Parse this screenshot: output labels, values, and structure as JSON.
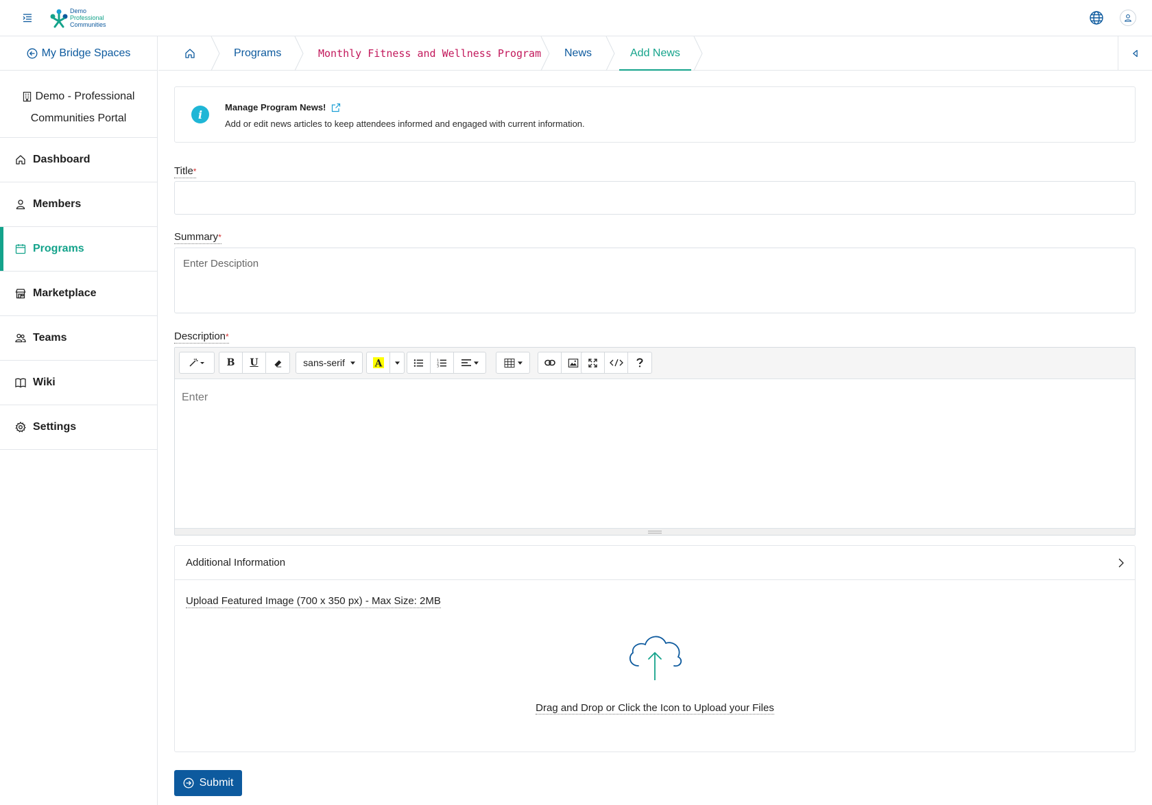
{
  "header": {
    "logo": {
      "line1": "Demo",
      "line2": "Professional",
      "line3": "Communities"
    },
    "icons": [
      "menu-icon",
      "globe-icon",
      "user-icon"
    ]
  },
  "sidebar": {
    "back_label": "My Bridge Spaces",
    "portal_line1": "Demo - Professional",
    "portal_line2": "Communities Portal",
    "items": [
      {
        "label": "Dashboard",
        "icon": "home-icon",
        "active": false
      },
      {
        "label": "Members",
        "icon": "user-icon",
        "active": false
      },
      {
        "label": "Programs",
        "icon": "calendar-icon",
        "active": true
      },
      {
        "label": "Marketplace",
        "icon": "store-icon",
        "active": false
      },
      {
        "label": "Teams",
        "icon": "team-icon",
        "active": false
      },
      {
        "label": "Wiki",
        "icon": "book-icon",
        "active": false
      },
      {
        "label": "Settings",
        "icon": "gear-icon",
        "active": false
      }
    ]
  },
  "breadcrumb": {
    "items": [
      "Programs",
      "Monthly Fitness and Wellness Program",
      "News",
      "Add News"
    ]
  },
  "info": {
    "title": "Manage Program News!",
    "description": "Add or edit news articles to keep attendees informed and engaged with current information."
  },
  "form": {
    "title_label": "Title",
    "summary_label": "Summary",
    "summary_placeholder": "Enter Desciption",
    "description_label": "Description",
    "editor_placeholder": "Enter",
    "font_family": "sans-serif",
    "required_mark": "*"
  },
  "additional": {
    "header": "Additional Information",
    "upload_label": "Upload Featured Image (700 x 350 px) - Max Size: 2MB",
    "upload_hint": "Drag and Drop or Click the Icon to Upload your Files"
  },
  "submit_label": "Submit",
  "colors": {
    "primary": "#0d5a9e",
    "accent": "#14a38b",
    "breadcrumb_program": "#c2185b",
    "info": "#1fb6d6"
  }
}
